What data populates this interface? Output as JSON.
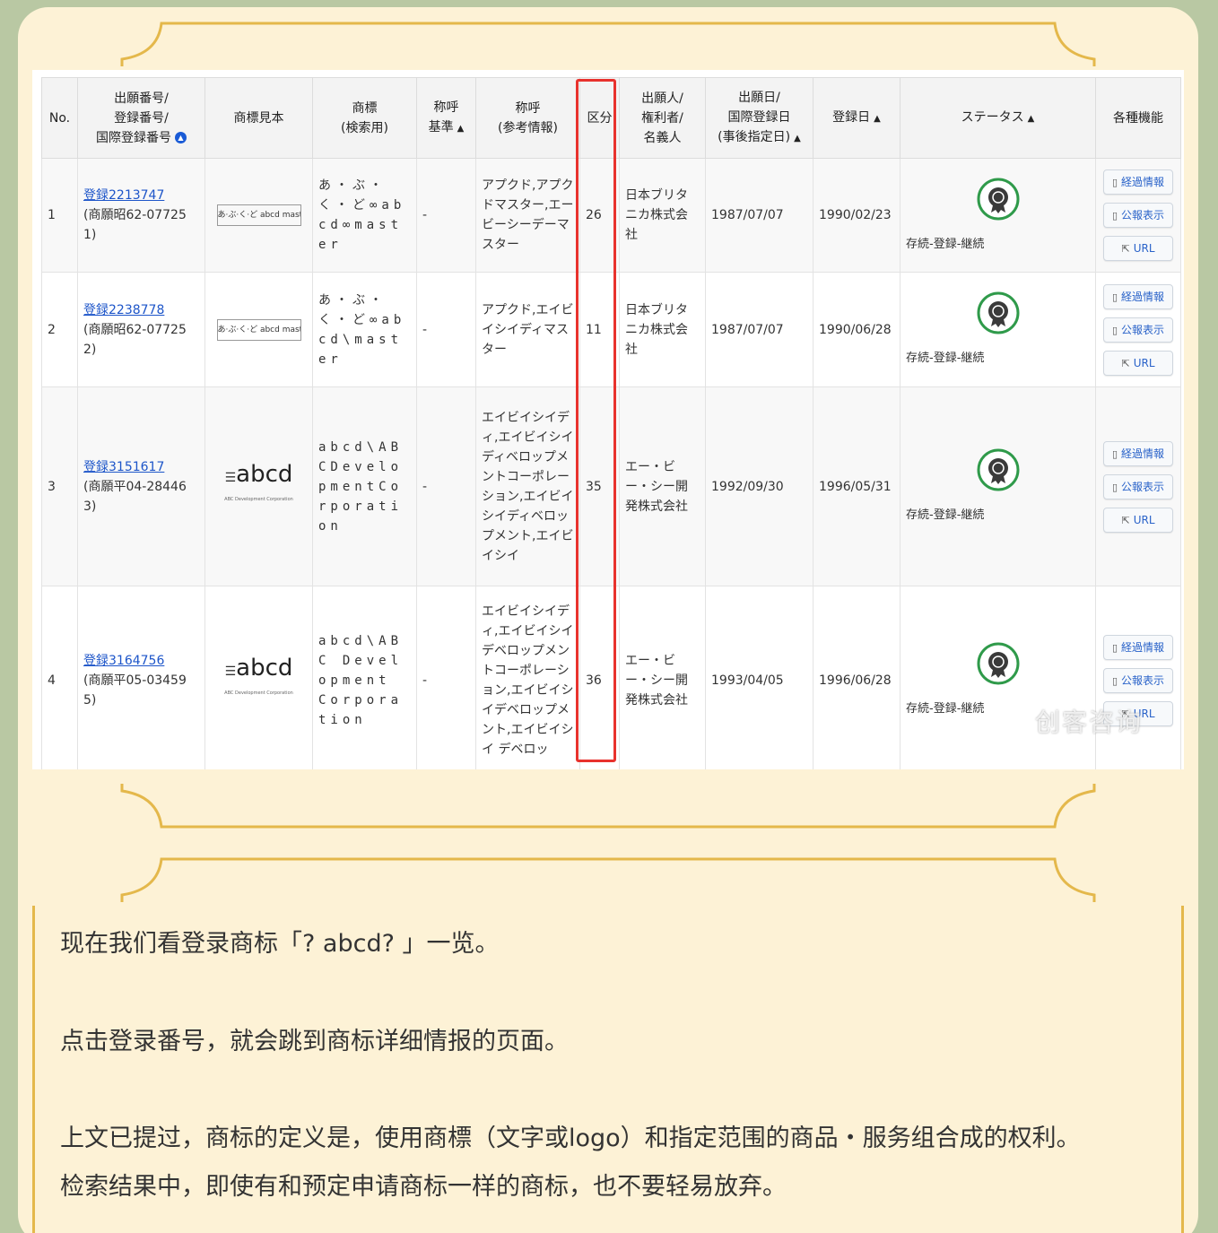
{
  "table": {
    "headers": [
      {
        "key": "no",
        "label": "No."
      },
      {
        "key": "number",
        "label": "出願番号/\n登録番号/\n国際登録番号",
        "sort": "circle"
      },
      {
        "key": "sample",
        "label": "商標見本"
      },
      {
        "key": "mark",
        "label": "商標\n(検索用)"
      },
      {
        "key": "yobi_kijun",
        "label": "称呼\n基準",
        "sort": "up"
      },
      {
        "key": "yobi",
        "label": "称呼\n(参考情報)"
      },
      {
        "key": "class",
        "label": "区分"
      },
      {
        "key": "holder",
        "label": "出願人/\n権利者/\n名義人"
      },
      {
        "key": "app_date",
        "label": "出願日/\n国際登録日\n(事後指定日)",
        "sort": "up"
      },
      {
        "key": "reg_date",
        "label": "登録日",
        "sort": "up"
      },
      {
        "key": "status",
        "label": "ステータス",
        "sort": "up"
      },
      {
        "key": "functions",
        "label": "各種機能"
      }
    ],
    "sort_up_glyph": "▲",
    "rows": [
      {
        "no": "1",
        "reg": "登録2213747",
        "app": "(商願昭62-07725\n1)",
        "sample_type": "small",
        "sample_text": "あ·ぶ·く·ど abcd master",
        "mark": "あ・ぶ・く・ど∞abcd∞master",
        "yobi_kijun": "-",
        "yobi": "アプクド,アプクドマスター,エービーシーデーマスター",
        "class": "26",
        "holder": "日本ブリタニカ株式会社",
        "app_date": "1987/07/07",
        "reg_date": "1990/02/23",
        "status": "存続-登録-継続"
      },
      {
        "no": "2",
        "reg": "登録2238778",
        "app": "(商願昭62-07725\n2)",
        "sample_type": "small",
        "sample_text": "あ·ぶ·く·ど abcd master",
        "mark": "あ・ぶ・く・ど∞abcd\\master",
        "yobi_kijun": "-",
        "yobi": "アプクド,エイビイシイディマスター",
        "class": "11",
        "holder": "日本ブリタニカ株式会社",
        "app_date": "1987/07/07",
        "reg_date": "1990/06/28",
        "status": "存続-登録-継続"
      },
      {
        "no": "3",
        "reg": "登録3151617",
        "app": "(商願平04-28446\n3)",
        "sample_type": "big",
        "sample_text": "abcd",
        "sample_sub": "ABC Development Corporation",
        "mark": "abcd\\ABCDevelopmentCorporation",
        "yobi_kijun": "-",
        "yobi": "エイビイシイディ,エイビイシイディベロップメントコーポレーション,エイビイシイディベロップメント,エイビイシイ",
        "class": "35",
        "holder": "エー・ビー・シー開発株式会社",
        "app_date": "1992/09/30",
        "reg_date": "1996/05/31",
        "status": "存続-登録-継続"
      },
      {
        "no": "4",
        "reg": "登録3164756",
        "app": "(商願平05-03459\n5)",
        "sample_type": "big",
        "sample_text": "abcd",
        "sample_sub": "ABC Development Corporation",
        "mark": "abcd\\ABC Development Corporation",
        "yobi_kijun": "-",
        "yobi": "エイビイシイディ,エイビイシイデベロップメントコーポレーション,エイビイシイデベロップメント,エイビイシイ デベロッ",
        "class": "36",
        "holder": "エー・ビー・シー開発株式会社",
        "app_date": "1993/04/05",
        "reg_date": "1996/06/28",
        "status": "存続-登録-継続"
      }
    ],
    "buttons": [
      {
        "label": "経過情報",
        "icon": "document-icon"
      },
      {
        "label": "公報表示",
        "icon": "document-icon"
      },
      {
        "label": "URL",
        "icon": "share-icon"
      }
    ]
  },
  "watermark": "创客咨询",
  "article": {
    "p1": "现在我们看登录商标「? abcd? 」一览。",
    "p2": "点击登录番号，就会跳到商标详细情报的页面。",
    "p3a": "上文已提过，商标的定义是，使用商標（文字或logo）和指定范围的商品・服务组合成的权利。",
    "p3b": "检索结果中，即使有和预定申请商标一样的商标，也不要轻易放弃。"
  },
  "colors": {
    "background": "#b9c8a3",
    "card": "#fdf2d6",
    "frame": "#e4b84b",
    "link": "#1d55c9",
    "highlight": "#e8322d"
  }
}
